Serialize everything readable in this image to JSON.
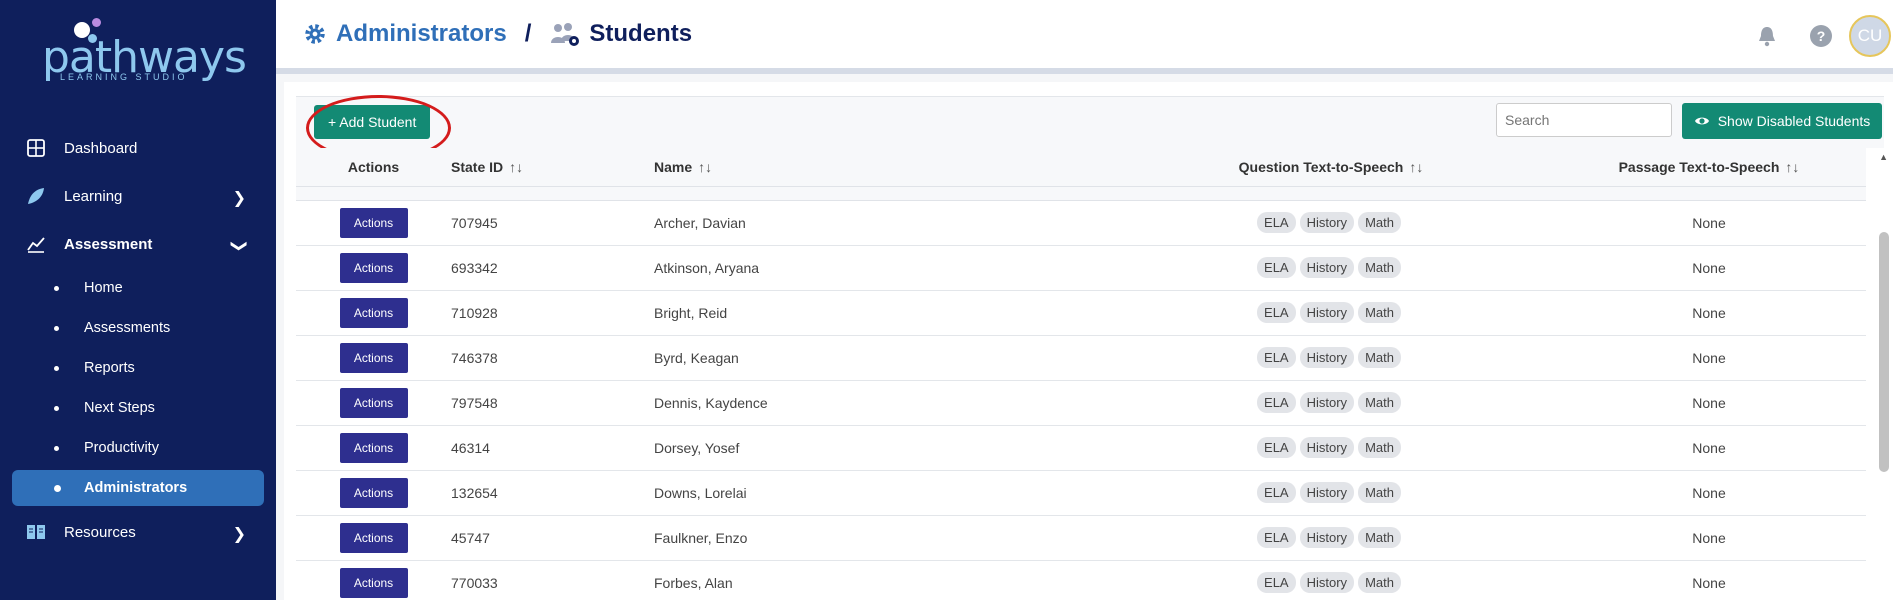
{
  "sidebar": {
    "logo": {
      "name": "pathways",
      "subtitle": "LEARNING STUDIO"
    },
    "items": [
      {
        "label": "Dashboard",
        "icon": "grid-icon"
      },
      {
        "label": "Learning",
        "icon": "leaf-icon"
      },
      {
        "label": "Assessment",
        "icon": "chart-icon"
      },
      {
        "label": "Resources",
        "icon": "book-icon"
      }
    ],
    "assessment_sub": [
      {
        "label": "Home"
      },
      {
        "label": "Assessments"
      },
      {
        "label": "Reports"
      },
      {
        "label": "Next Steps"
      },
      {
        "label": "Productivity"
      },
      {
        "label": "Administrators",
        "active": true
      }
    ]
  },
  "header": {
    "crumb_parent": "Administrators",
    "crumb_separator": "/",
    "crumb_current": "Students",
    "avatar_initials": "CU"
  },
  "toolbar": {
    "add_label": "+ Add Student",
    "search_placeholder": "Search",
    "show_disabled_label": "Show Disabled Students"
  },
  "table": {
    "columns": [
      "Actions",
      "State ID",
      "Name",
      "Question Text-to-Speech",
      "Passage Text-to-Speech"
    ],
    "actions_label": "Actions",
    "rows": [
      {
        "state_id": "707945",
        "name": "Archer, Davian",
        "question_tts": [
          "ELA",
          "History",
          "Math"
        ],
        "passage_tts": "None"
      },
      {
        "state_id": "693342",
        "name": "Atkinson, Aryana",
        "question_tts": [
          "ELA",
          "History",
          "Math"
        ],
        "passage_tts": "None"
      },
      {
        "state_id": "710928",
        "name": "Bright, Reid",
        "question_tts": [
          "ELA",
          "History",
          "Math"
        ],
        "passage_tts": "None"
      },
      {
        "state_id": "746378",
        "name": "Byrd, Keagan",
        "question_tts": [
          "ELA",
          "History",
          "Math"
        ],
        "passage_tts": "None"
      },
      {
        "state_id": "797548",
        "name": "Dennis, Kaydence",
        "question_tts": [
          "ELA",
          "History",
          "Math"
        ],
        "passage_tts": "None"
      },
      {
        "state_id": "46314",
        "name": "Dorsey, Yosef",
        "question_tts": [
          "ELA",
          "History",
          "Math"
        ],
        "passage_tts": "None"
      },
      {
        "state_id": "132654",
        "name": "Downs, Lorelai",
        "question_tts": [
          "ELA",
          "History",
          "Math"
        ],
        "passage_tts": "None"
      },
      {
        "state_id": "45747",
        "name": "Faulkner, Enzo",
        "question_tts": [
          "ELA",
          "History",
          "Math"
        ],
        "passage_tts": "None"
      },
      {
        "state_id": "770033",
        "name": "Forbes, Alan",
        "question_tts": [
          "ELA",
          "History",
          "Math"
        ],
        "passage_tts": "None"
      }
    ]
  },
  "colors": {
    "sidebar_bg": "#0f1f5c",
    "active_item": "#2f6fb8",
    "primary_button": "#138a74",
    "actions_button": "#2e2f8f",
    "annotation_circle": "#d41c1c"
  }
}
